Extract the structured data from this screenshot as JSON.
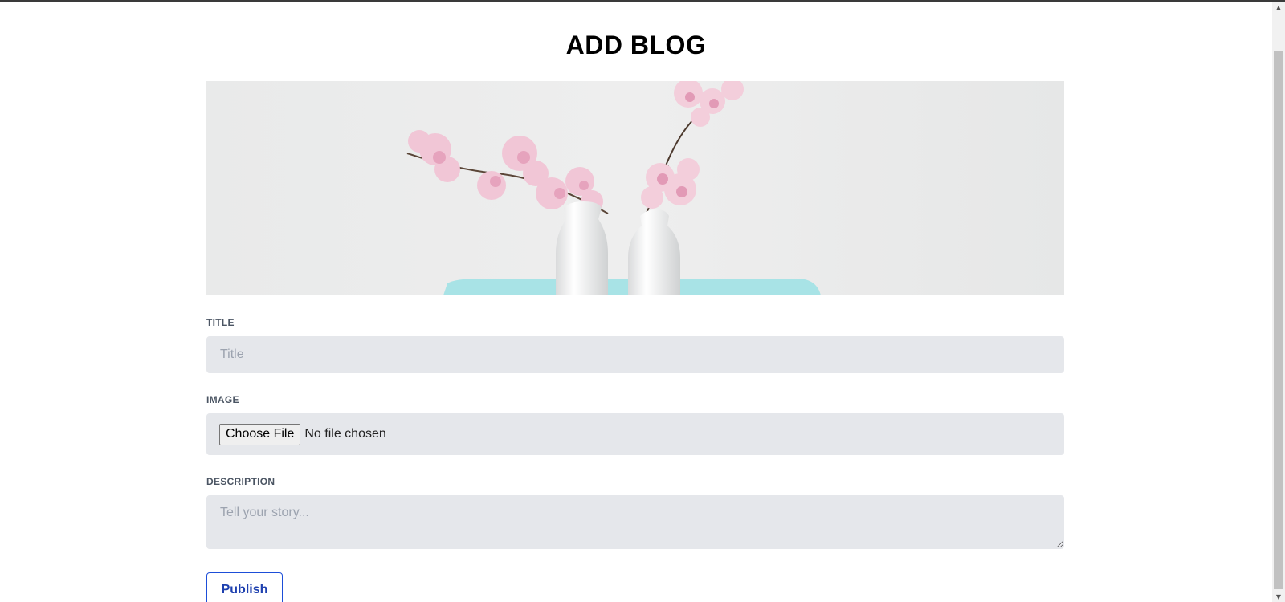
{
  "page": {
    "title": "ADD BLOG"
  },
  "form": {
    "title_label": "TITLE",
    "title_placeholder": "Title",
    "title_value": "",
    "image_label": "IMAGE",
    "choose_file_label": "Choose File",
    "file_status": "No file chosen",
    "description_label": "DESCRIPTION",
    "description_placeholder": "Tell your story...",
    "description_value": "",
    "publish_label": "Publish"
  },
  "scrollbar": {
    "up_icon": "triangle-up",
    "down_icon": "triangle-down"
  },
  "colors": {
    "input_background": "#e5e7eb",
    "label_color": "#4b5563",
    "publish_accent": "#1e40af"
  }
}
